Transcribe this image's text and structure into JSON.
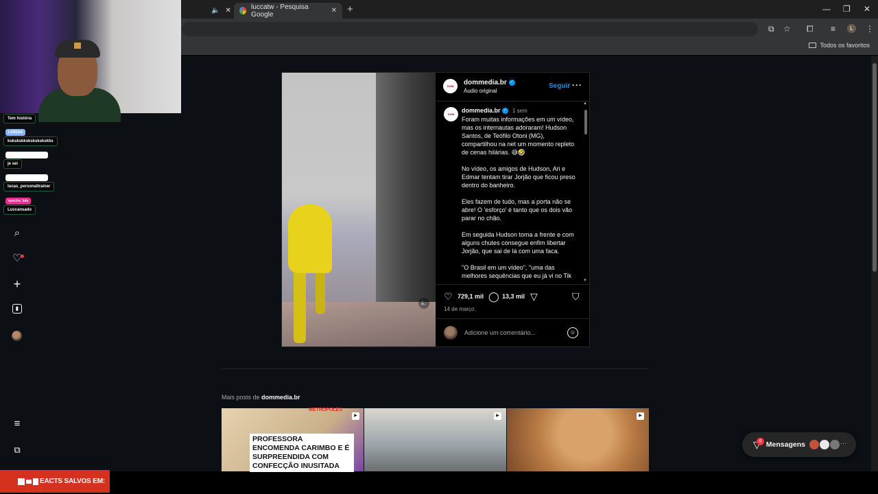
{
  "browser": {
    "tabs": [
      {
        "label": ""
      },
      {
        "label": "luccatw - Pesquisa Google"
      }
    ],
    "bookmarks_folder": "Todos os favoritos",
    "profile_initial": "L"
  },
  "chat": {
    "messages": [
      "Tem história",
      "kskskskkskskskskskks",
      "je sei",
      "lucas_personaltrainer",
      "Luccansado"
    ],
    "pills": [
      "LAREGA",
      "spectra_lulu"
    ]
  },
  "post": {
    "username": "dommedia.br",
    "subtitle": "Áudio original",
    "follow_label": "Seguir",
    "time": "1 sem",
    "caption": [
      "Foram muitas informações em um vídeo, mas os internautas adoraram! Hudson Santos, de Teófilo Otoni (MG), compartilhou na net um momento repleto de cenas hilárias. 😅🤣",
      "No vídeo, os amigos de Hudson, Ari e Edmar tentam tirar Jorjão que ficou preso dentro do banheiro.",
      "Eles fazem de tudo, mas a porta não se abre! O 'esforço' é tanto que os dois vão parar no chão.",
      "Em seguida Hudson toma a frente e com alguns chutes consegue enfim libertar Jorjão, que sai de lá com uma faca.",
      "\"O Brasil em um vídeo\", \"uma das melhores sequências que eu já vi no Tik"
    ],
    "likes": "729,1 mil",
    "comments": "13,3 mil",
    "date": "14 de março",
    "comment_placeholder": "Adicione um comentário..."
  },
  "more_posts": {
    "prefix": "Mais posts de",
    "username": "dommedia.br",
    "thumb1_text": "PROFESSORA ENCOMENDA CARIMBO E É SURPREENDIDA COM CONFECÇÃO INUSITADA",
    "thumb1_tag": "METROPOLES"
  },
  "messages": {
    "label": "Mensagens",
    "badge": "6"
  },
  "overlay_banner": "EACTS SALVOS EM:",
  "colors": {
    "accent": "#0095f6",
    "notification": "#ff3040",
    "banner": "#d4321f"
  }
}
